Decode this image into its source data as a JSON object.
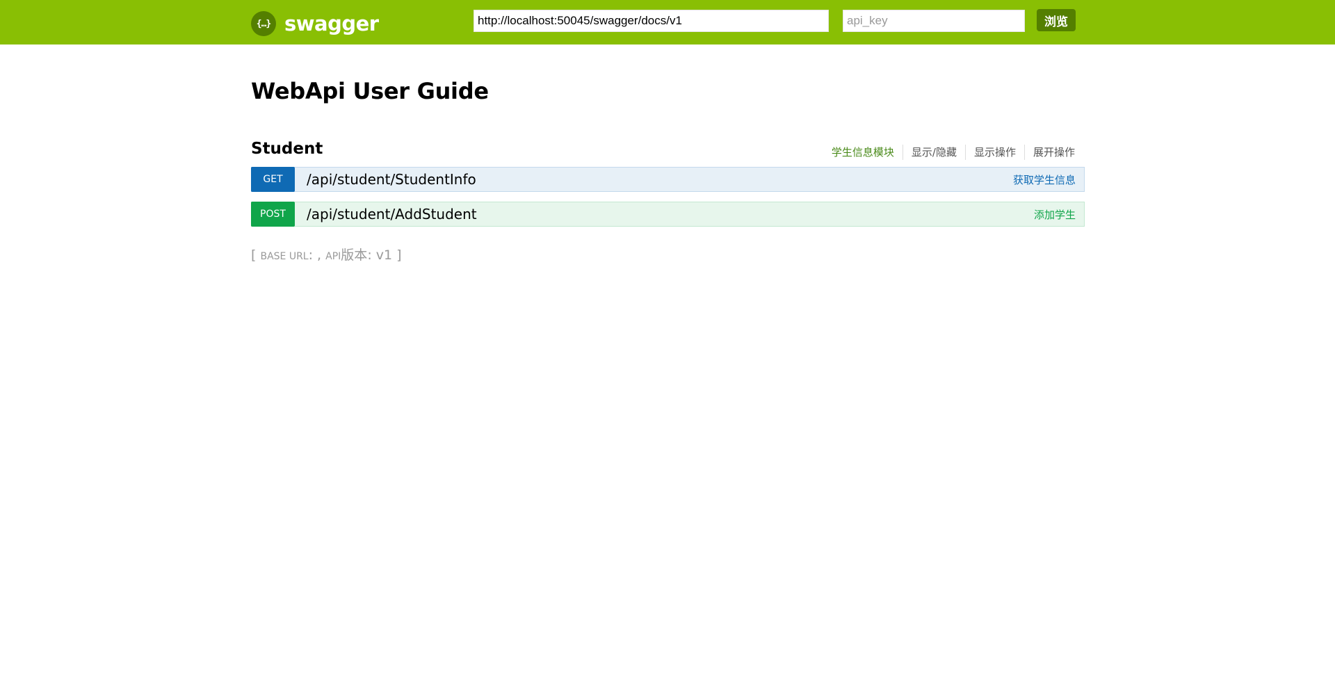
{
  "header": {
    "logo_mark": "{…}",
    "logo_text": "swagger",
    "url_value": "http://localhost:50045/swagger/docs/v1",
    "api_key_placeholder": "api_key",
    "explore_label": "浏览",
    "background_color": "#89bf04"
  },
  "title": "WebApi User Guide",
  "resource": {
    "name": "Student",
    "actions": [
      "学生信息模块",
      "显示/隐藏",
      "显示操作",
      "展开操作"
    ]
  },
  "operations": [
    {
      "method": "GET",
      "path": "/api/student/StudentInfo",
      "summary": "获取学生信息",
      "color": "#0f6ab4"
    },
    {
      "method": "POST",
      "path": "/api/student/AddStudent",
      "summary": "添加学生",
      "color": "#10a54a"
    }
  ],
  "footer": {
    "open_bracket": "[",
    "base_url_label": "BASE URL",
    "base_url_separator": ": ,",
    "api_label": "API",
    "version_label": "版本",
    "version_value": ": v1",
    "close_bracket": "]"
  }
}
